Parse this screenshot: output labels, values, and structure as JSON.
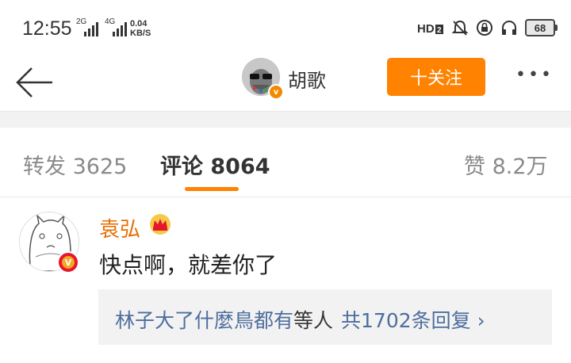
{
  "status_bar": {
    "time": "12:55",
    "network1": "2G",
    "network2": "4G",
    "speed_value": "0.04",
    "speed_unit": "KB/S",
    "battery": "68"
  },
  "nav": {
    "user_name": "胡歌",
    "follow_label": "十关注",
    "more_label": "•••"
  },
  "tabs": [
    {
      "label": "转发 3625"
    },
    {
      "label": "评论 8064"
    },
    {
      "label": "赞 8.2万"
    }
  ],
  "comment": {
    "user_name": "袁弘",
    "text": "快点啊，就差你了",
    "reply": {
      "user": "林子大了什麼鳥都有",
      "text": "等人",
      "count_label": "共1702条回复",
      "chevron": "›"
    }
  },
  "colors": {
    "accent": "#ff8200",
    "link": "#4e6e9e",
    "name": "#e86f00"
  }
}
